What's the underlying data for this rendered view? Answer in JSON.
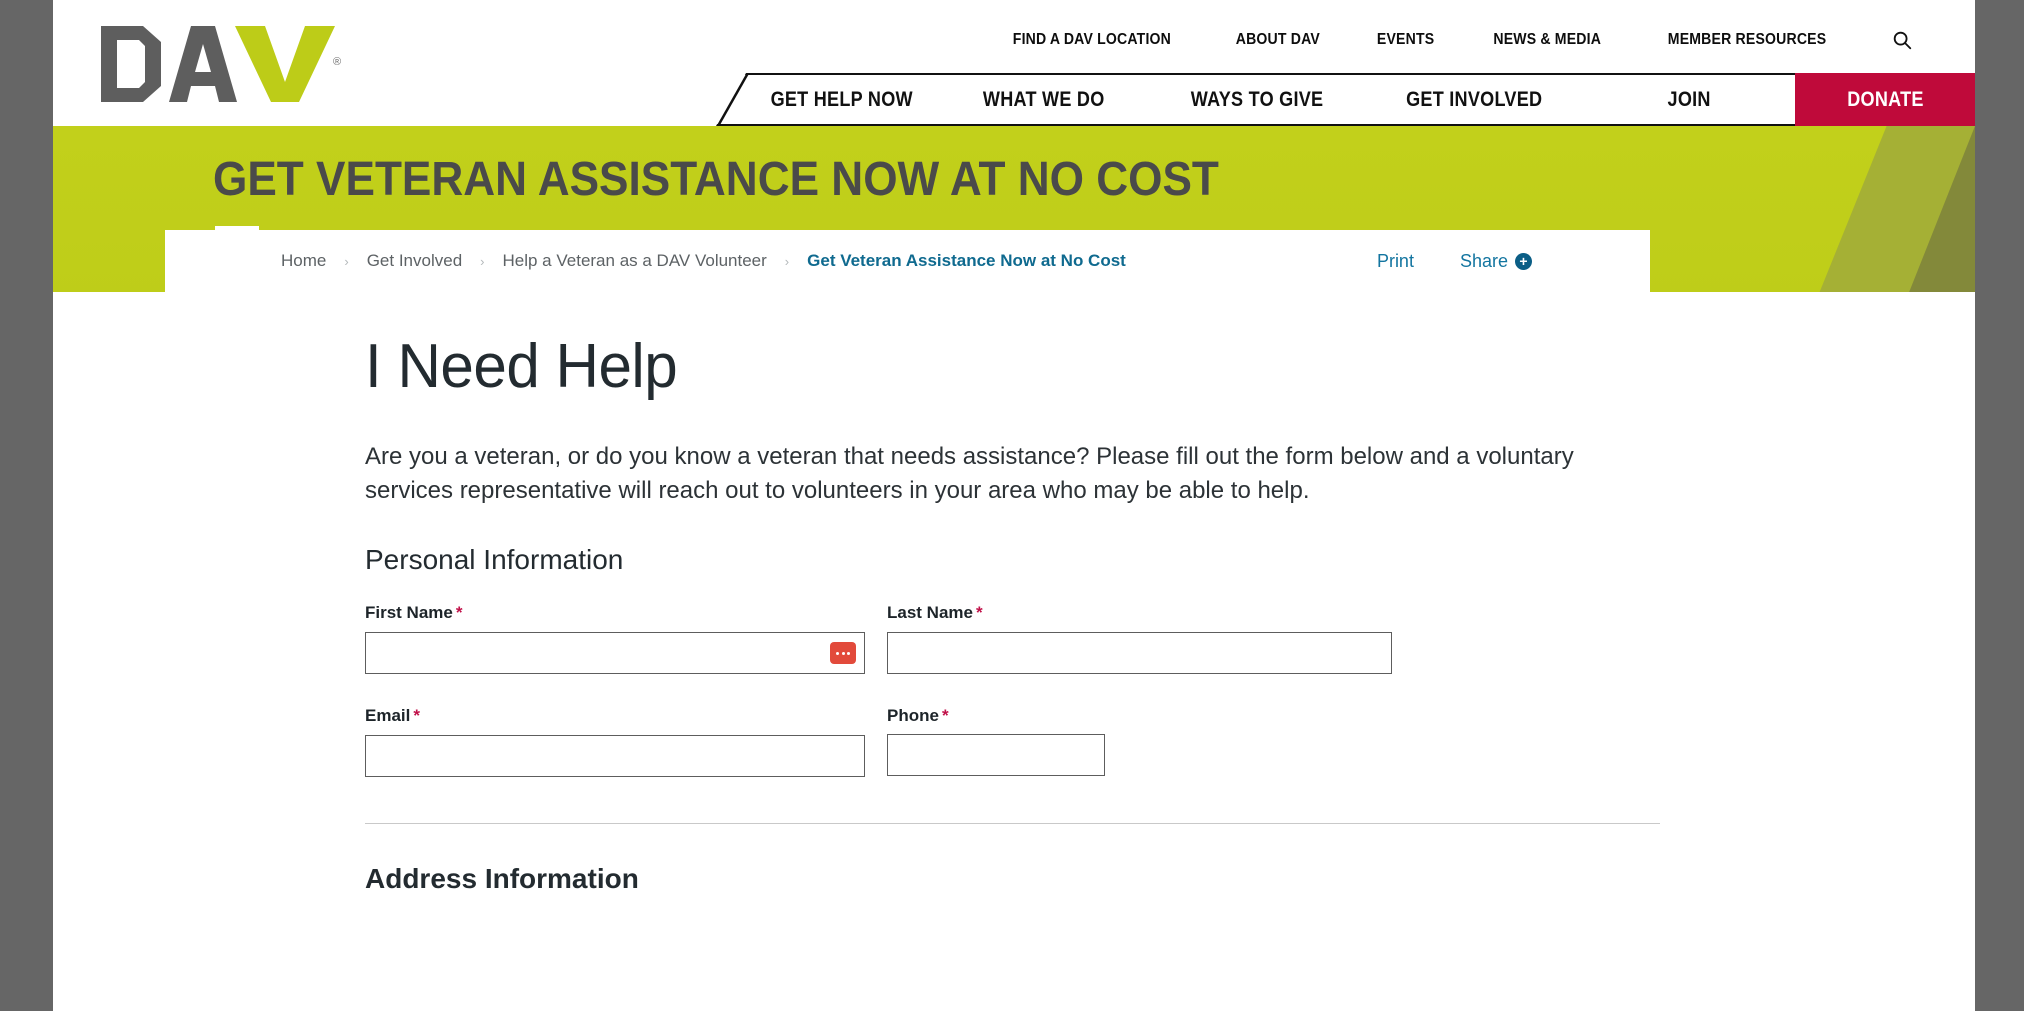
{
  "brand": {
    "logo_text": "DAV",
    "registered_mark": "®",
    "logo_gray": "#5e5e5e",
    "logo_green": "#bdcc18",
    "donate_red": "#bf0a3a",
    "hero_green": "#c2d01b",
    "link_teal": "#1375a0"
  },
  "utility_nav": {
    "items": [
      {
        "label": "FIND A DAV LOCATION"
      },
      {
        "label": "ABOUT DAV"
      },
      {
        "label": "EVENTS"
      },
      {
        "label": "NEWS & MEDIA"
      },
      {
        "label": "MEMBER RESOURCES"
      }
    ],
    "search_icon": "search-icon"
  },
  "main_nav": {
    "items": [
      {
        "label": "GET HELP NOW"
      },
      {
        "label": "WHAT WE DO"
      },
      {
        "label": "WAYS TO GIVE"
      },
      {
        "label": "GET INVOLVED"
      },
      {
        "label": "JOIN"
      }
    ],
    "donate_label": "DONATE"
  },
  "hero": {
    "title": "GET VETERAN ASSISTANCE NOW AT NO COST"
  },
  "breadcrumb": {
    "separator": "›",
    "items": [
      {
        "label": "Home",
        "active": false
      },
      {
        "label": "Get Involved",
        "active": false
      },
      {
        "label": "Help a Veteran as a DAV Volunteer",
        "active": false
      },
      {
        "label": "Get Veteran Assistance Now at No Cost",
        "active": true
      }
    ]
  },
  "page_tools": {
    "print_label": "Print",
    "share_label": "Share",
    "share_icon": "plus-circle-icon"
  },
  "content": {
    "page_title": "I Need Help",
    "intro": "Are you a veteran, or do you know a veteran that needs assistance? Please fill out the form below and a voluntary services representative will reach out to volunteers in your area who may be able to help."
  },
  "form": {
    "personal_section_title": "Personal Information",
    "address_section_title": "Address Information",
    "required_marker": "*",
    "fields": {
      "first_name": {
        "label": "First Name",
        "value": "",
        "placeholder": "",
        "required": true
      },
      "last_name": {
        "label": "Last Name",
        "value": "",
        "placeholder": "",
        "required": true
      },
      "email": {
        "label": "Email",
        "value": "",
        "placeholder": "",
        "required": true
      },
      "phone": {
        "label": "Phone",
        "value": "",
        "placeholder": "",
        "required": true
      }
    },
    "autofill_icon": "autofill-dots-icon"
  }
}
